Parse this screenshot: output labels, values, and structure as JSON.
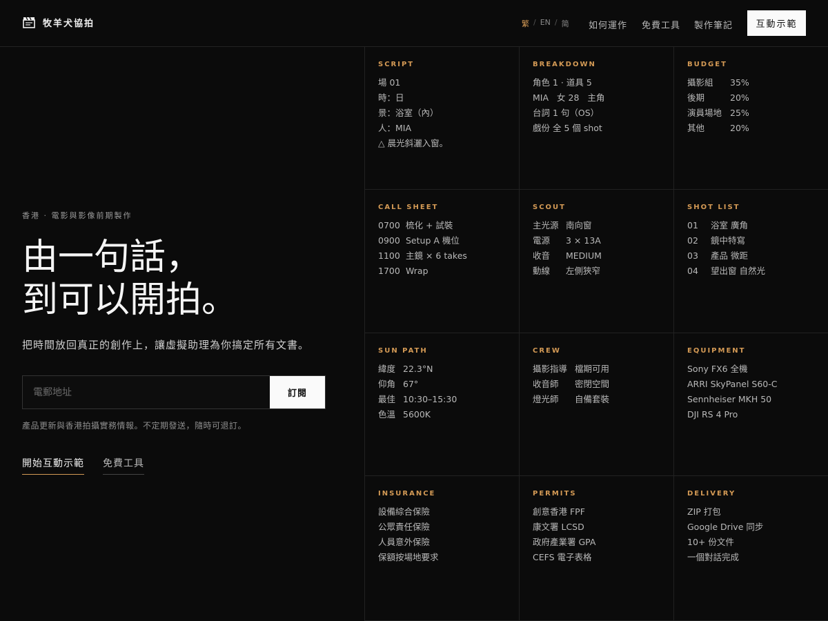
{
  "brand": {
    "name": "牧羊犬協拍",
    "icon": "clapperboard-icon"
  },
  "header": {
    "lang": {
      "trad": "繁",
      "en": "EN",
      "simp": "简",
      "sep": "/"
    },
    "nav": [
      "如何運作",
      "免費工具",
      "製作筆記"
    ],
    "demo_button": "互動示範"
  },
  "hero": {
    "eyebrow": "香港 · 電影與影像前期製作",
    "title_line1": "由一句話，",
    "title_line2": "到可以開拍。",
    "subtitle": "把時間放回真正的創作上，讓虛擬助理為你搞定所有文書。",
    "email_placeholder": "電郵地址",
    "subscribe_button": "訂閱",
    "note": "產品更新與香港拍攝實務情報。不定期發送，隨時可退訂。",
    "link_demo": "開始互動示範",
    "link_tools": "免費工具"
  },
  "cards": [
    {
      "title": "SCRIPT",
      "lines": [
        [
          "場 01"
        ],
        [
          "時：日"
        ],
        [
          "景：浴室（內）"
        ],
        [
          "人：MIA"
        ],
        [
          "△ 晨光斜灑入窗。"
        ]
      ]
    },
    {
      "title": "BREAKDOWN",
      "lines": [
        [
          "角色 1 · 道具 5"
        ],
        [
          "MIA",
          "女 28",
          "主角"
        ],
        [
          "台詞 1 句（OS）"
        ],
        [
          "戲份 全 5 個 shot"
        ]
      ]
    },
    {
      "title": "BUDGET",
      "lines": [
        [
          "攝影組",
          "35%"
        ],
        [
          "後期",
          "20%"
        ],
        [
          "演員場地",
          "25%"
        ],
        [
          "其他",
          "20%"
        ]
      ]
    },
    {
      "title": "CALL SHEET",
      "lines": [
        [
          "0700",
          "梳化 + 試裝"
        ],
        [
          "0900",
          "Setup A 機位"
        ],
        [
          "1100",
          "主鏡 × 6 takes"
        ],
        [
          "1700",
          "Wrap"
        ]
      ]
    },
    {
      "title": "SCOUT",
      "lines": [
        [
          "主光源",
          "南向窗"
        ],
        [
          "電源",
          "3 × 13A"
        ],
        [
          "收音",
          "MEDIUM"
        ],
        [
          "動線",
          "左側狹窄"
        ]
      ]
    },
    {
      "title": "SHOT LIST",
      "lines": [
        [
          "01",
          "浴室 廣角"
        ],
        [
          "02",
          "鏡中特寫"
        ],
        [
          "03",
          "產品 微距"
        ],
        [
          "04",
          "望出窗 自然光"
        ]
      ]
    },
    {
      "title": "SUN PATH",
      "lines": [
        [
          "緯度",
          "22.3°N"
        ],
        [
          "仰角",
          "67°"
        ],
        [
          "最佳",
          "10:30–15:30"
        ],
        [
          "色溫",
          "5600K"
        ]
      ]
    },
    {
      "title": "CREW",
      "lines": [
        [
          "攝影指導",
          "檔期可用"
        ],
        [
          "收音師",
          "密閉空間"
        ],
        [
          "燈光師",
          "自備套裝"
        ]
      ]
    },
    {
      "title": "EQUIPMENT",
      "lines": [
        [
          "Sony FX6 全機"
        ],
        [
          "ARRI SkyPanel S60-C"
        ],
        [
          "Sennheiser MKH 50"
        ],
        [
          "DJI RS 4 Pro"
        ]
      ]
    },
    {
      "title": "INSURANCE",
      "lines": [
        [
          "設備綜合保險"
        ],
        [
          "公眾責任保險"
        ],
        [
          "人員意外保險"
        ],
        [
          "保額按場地要求"
        ]
      ]
    },
    {
      "title": "PERMITS",
      "lines": [
        [
          "創意香港 FPF"
        ],
        [
          "康文署 LCSD"
        ],
        [
          "政府產業署 GPA"
        ],
        [
          "CEFS 電子表格"
        ]
      ]
    },
    {
      "title": "DELIVERY",
      "lines": [
        [
          "ZIP 打包"
        ],
        [
          "Google Drive 同步"
        ],
        [
          "10+ 份文件"
        ],
        [
          "一個對話完成"
        ]
      ]
    }
  ],
  "colors": {
    "accent": "#d49a55",
    "background": "#0b0b0b"
  }
}
